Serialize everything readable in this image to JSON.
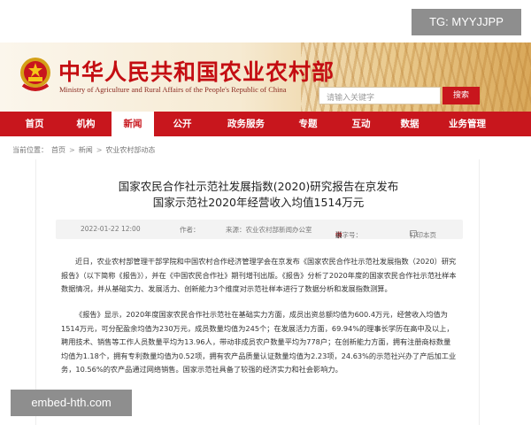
{
  "overlays": {
    "tg_label": "TG: MYYJJPP",
    "embed_label": "embed-hth.com"
  },
  "header": {
    "title": "中华人民共和国农业农村部",
    "subtitle": "Ministry of Agriculture and Rural Affairs of the People's Republic of China",
    "search_placeholder": "请输入关键字",
    "search_button": "搜索",
    "colors": {
      "brand_red": "#c8161d",
      "title_red": "#c40d12"
    }
  },
  "nav": {
    "items": [
      {
        "label": "首页"
      },
      {
        "label": "机构"
      },
      {
        "label": "新闻"
      },
      {
        "label": "公开"
      },
      {
        "label": "政务服务"
      },
      {
        "label": "专题"
      },
      {
        "label": "互动"
      },
      {
        "label": "数据"
      },
      {
        "label": "业务管理"
      }
    ],
    "active_label": "新闻"
  },
  "breadcrumb": {
    "prefix": "当前位置：",
    "items": [
      "首页",
      "新闻",
      "农业农村部动态"
    ]
  },
  "article": {
    "headline_line1": "国家农民合作社示范社发展指数(2020)研究报告在京发布",
    "headline_line2": "国家示范社2020年经营收入均值1514万元",
    "meta": {
      "date": "2022-01-22 12:00",
      "author_label": "作者：",
      "source": "来源：农业农村部新闻办公室",
      "font_label": "【字号：",
      "font_big": "大",
      "font_mid": "中",
      "font_small": "小",
      "font_close": "】",
      "print_label": "打印本页"
    },
    "paragraph1": "近日，农业农村部管理干部学院和中国农村合作经济管理学会在京发布《国家农民合作社示范社发展指数（2020）研究报告》（以下简称《报告》），并在《中国农民合作社》期刊增刊出版。《报告》分析了2020年度的国家农民合作社示范社样本数据情况，并从基础实力、发展活力、创新能力3个维度对示范社样本进行了数据分析和发展指数测算。",
    "paragraph2": "《报告》显示，2020年度国家农民合作社示范社在基础实力方面，成员出资总额均值为600.4万元，经营收入均值为1514万元，可分配盈余均值为230万元，成员数量均值为245个；在发展活力方面，69.94%的理事长学历在高中及以上，聘用技术、销售等工作人员数量平均为13.96人，带动非成员农户数量平均为778户；在创新能力方面，拥有注册商标数量均值为1.18个，拥有专利数量均值为0.52项，拥有农产品质量认证数量均值为2.23项，24.63%的示范社兴办了产后加工业务，10.56%的农产品通过网络销售。国家示范社具备了较强的经济实力和社会影响力。"
  }
}
